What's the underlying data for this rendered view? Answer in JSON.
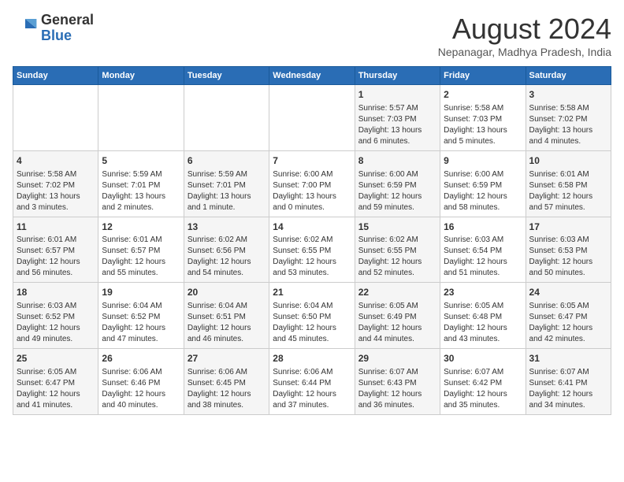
{
  "logo": {
    "general": "General",
    "blue": "Blue"
  },
  "title": "August 2024",
  "subtitle": "Nepanagar, Madhya Pradesh, India",
  "days_of_week": [
    "Sunday",
    "Monday",
    "Tuesday",
    "Wednesday",
    "Thursday",
    "Friday",
    "Saturday"
  ],
  "weeks": [
    [
      {
        "day": "",
        "info": ""
      },
      {
        "day": "",
        "info": ""
      },
      {
        "day": "",
        "info": ""
      },
      {
        "day": "",
        "info": ""
      },
      {
        "day": "1",
        "info": "Sunrise: 5:57 AM\nSunset: 7:03 PM\nDaylight: 13 hours\nand 6 minutes."
      },
      {
        "day": "2",
        "info": "Sunrise: 5:58 AM\nSunset: 7:03 PM\nDaylight: 13 hours\nand 5 minutes."
      },
      {
        "day": "3",
        "info": "Sunrise: 5:58 AM\nSunset: 7:02 PM\nDaylight: 13 hours\nand 4 minutes."
      }
    ],
    [
      {
        "day": "4",
        "info": "Sunrise: 5:58 AM\nSunset: 7:02 PM\nDaylight: 13 hours\nand 3 minutes."
      },
      {
        "day": "5",
        "info": "Sunrise: 5:59 AM\nSunset: 7:01 PM\nDaylight: 13 hours\nand 2 minutes."
      },
      {
        "day": "6",
        "info": "Sunrise: 5:59 AM\nSunset: 7:01 PM\nDaylight: 13 hours\nand 1 minute."
      },
      {
        "day": "7",
        "info": "Sunrise: 6:00 AM\nSunset: 7:00 PM\nDaylight: 13 hours\nand 0 minutes."
      },
      {
        "day": "8",
        "info": "Sunrise: 6:00 AM\nSunset: 6:59 PM\nDaylight: 12 hours\nand 59 minutes."
      },
      {
        "day": "9",
        "info": "Sunrise: 6:00 AM\nSunset: 6:59 PM\nDaylight: 12 hours\nand 58 minutes."
      },
      {
        "day": "10",
        "info": "Sunrise: 6:01 AM\nSunset: 6:58 PM\nDaylight: 12 hours\nand 57 minutes."
      }
    ],
    [
      {
        "day": "11",
        "info": "Sunrise: 6:01 AM\nSunset: 6:57 PM\nDaylight: 12 hours\nand 56 minutes."
      },
      {
        "day": "12",
        "info": "Sunrise: 6:01 AM\nSunset: 6:57 PM\nDaylight: 12 hours\nand 55 minutes."
      },
      {
        "day": "13",
        "info": "Sunrise: 6:02 AM\nSunset: 6:56 PM\nDaylight: 12 hours\nand 54 minutes."
      },
      {
        "day": "14",
        "info": "Sunrise: 6:02 AM\nSunset: 6:55 PM\nDaylight: 12 hours\nand 53 minutes."
      },
      {
        "day": "15",
        "info": "Sunrise: 6:02 AM\nSunset: 6:55 PM\nDaylight: 12 hours\nand 52 minutes."
      },
      {
        "day": "16",
        "info": "Sunrise: 6:03 AM\nSunset: 6:54 PM\nDaylight: 12 hours\nand 51 minutes."
      },
      {
        "day": "17",
        "info": "Sunrise: 6:03 AM\nSunset: 6:53 PM\nDaylight: 12 hours\nand 50 minutes."
      }
    ],
    [
      {
        "day": "18",
        "info": "Sunrise: 6:03 AM\nSunset: 6:52 PM\nDaylight: 12 hours\nand 49 minutes."
      },
      {
        "day": "19",
        "info": "Sunrise: 6:04 AM\nSunset: 6:52 PM\nDaylight: 12 hours\nand 47 minutes."
      },
      {
        "day": "20",
        "info": "Sunrise: 6:04 AM\nSunset: 6:51 PM\nDaylight: 12 hours\nand 46 minutes."
      },
      {
        "day": "21",
        "info": "Sunrise: 6:04 AM\nSunset: 6:50 PM\nDaylight: 12 hours\nand 45 minutes."
      },
      {
        "day": "22",
        "info": "Sunrise: 6:05 AM\nSunset: 6:49 PM\nDaylight: 12 hours\nand 44 minutes."
      },
      {
        "day": "23",
        "info": "Sunrise: 6:05 AM\nSunset: 6:48 PM\nDaylight: 12 hours\nand 43 minutes."
      },
      {
        "day": "24",
        "info": "Sunrise: 6:05 AM\nSunset: 6:47 PM\nDaylight: 12 hours\nand 42 minutes."
      }
    ],
    [
      {
        "day": "25",
        "info": "Sunrise: 6:05 AM\nSunset: 6:47 PM\nDaylight: 12 hours\nand 41 minutes."
      },
      {
        "day": "26",
        "info": "Sunrise: 6:06 AM\nSunset: 6:46 PM\nDaylight: 12 hours\nand 40 minutes."
      },
      {
        "day": "27",
        "info": "Sunrise: 6:06 AM\nSunset: 6:45 PM\nDaylight: 12 hours\nand 38 minutes."
      },
      {
        "day": "28",
        "info": "Sunrise: 6:06 AM\nSunset: 6:44 PM\nDaylight: 12 hours\nand 37 minutes."
      },
      {
        "day": "29",
        "info": "Sunrise: 6:07 AM\nSunset: 6:43 PM\nDaylight: 12 hours\nand 36 minutes."
      },
      {
        "day": "30",
        "info": "Sunrise: 6:07 AM\nSunset: 6:42 PM\nDaylight: 12 hours\nand 35 minutes."
      },
      {
        "day": "31",
        "info": "Sunrise: 6:07 AM\nSunset: 6:41 PM\nDaylight: 12 hours\nand 34 minutes."
      }
    ]
  ]
}
